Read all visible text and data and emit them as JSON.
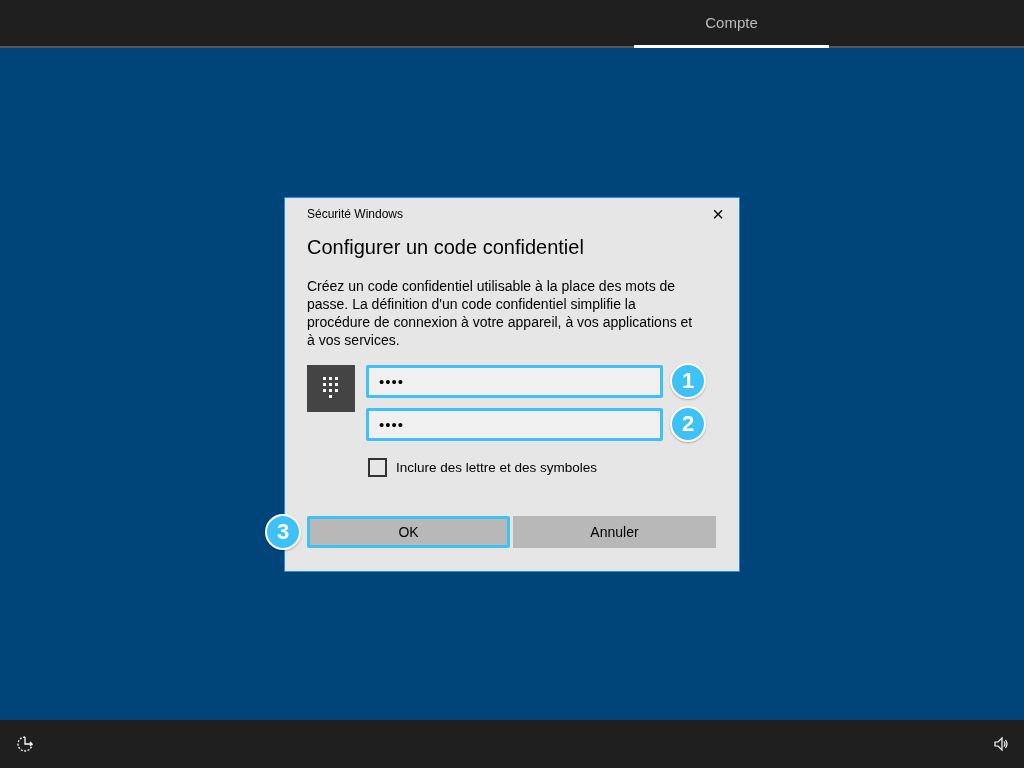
{
  "top_bar": {
    "tabs": [
      {
        "label": "Compte",
        "selected": true
      }
    ]
  },
  "dialog": {
    "caption": "Sécurité Windows",
    "close": "×",
    "title": "Configurer un code confidentiel",
    "description": "Créez un code confidentiel utilisable à la place des mots de passe. La définition d'un code confidentiel simplifie la procédure de connexion à votre appareil, à vos applications et à vos services.",
    "fields": [
      {
        "value": "••••",
        "highlighted": true,
        "callout": "1"
      },
      {
        "value": "••••",
        "highlighted": true,
        "callout": "2"
      }
    ],
    "checkbox": {
      "label": "Inclure des lettre et des symboles",
      "checked": false
    },
    "buttons": [
      {
        "label": "OK",
        "highlighted": true,
        "callout": "3"
      },
      {
        "label": "Annuler",
        "highlighted": false
      }
    ]
  }
}
